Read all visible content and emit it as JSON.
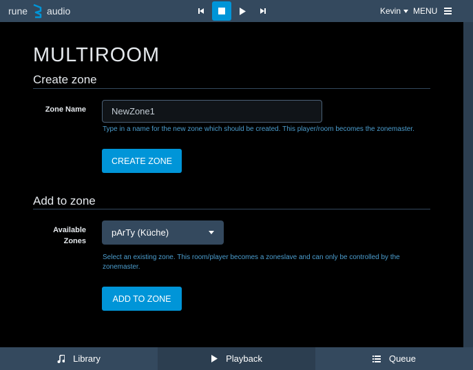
{
  "header": {
    "logo_left": "rune",
    "logo_right": "audio",
    "user": "Kevin",
    "menu_label": "MENU"
  },
  "page": {
    "title": "MULTIROOM",
    "create": {
      "section_title": "Create zone",
      "field_label": "Zone Name",
      "input_value": "NewZone1",
      "help": "Type in a name for the new zone which should be created. This player/room becomes the zonemaster.",
      "button": "CREATE ZONE"
    },
    "add": {
      "section_title": "Add to zone",
      "field_label_line1": "Available",
      "field_label_line2": "Zones",
      "selected_option": "pArTy (Küche)",
      "help_line1": "Select an existing zone. This room/player becomes a zoneslave and can only be controlled by the",
      "help_line2": "zonemaster.",
      "button": "ADD TO ZONE"
    }
  },
  "tabs": [
    {
      "label": "Library",
      "icon": "music-note-icon"
    },
    {
      "label": "Playback",
      "icon": "play-icon"
    },
    {
      "label": "Queue",
      "icon": "list-icon"
    }
  ],
  "colors": {
    "accent": "#0095d8",
    "bar": "#34495e",
    "help_text": "#4c9ecf"
  }
}
